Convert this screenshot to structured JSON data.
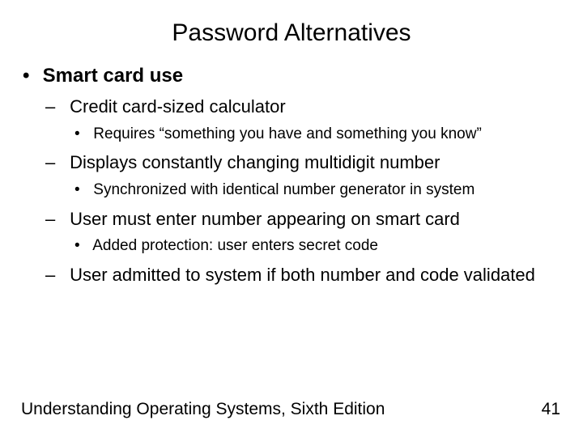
{
  "title": "Password Alternatives",
  "bullets": {
    "l1_0": "Smart card use",
    "l2_0": "Credit card-sized calculator",
    "l3_0": "Requires “something you have and something you know”",
    "l2_1": "Displays constantly changing multidigit number",
    "l3_1": "Synchronized with identical number generator in system",
    "l2_2": "User must enter number appearing on smart card",
    "l3_2": "Added protection: user enters secret code",
    "l2_3": "User admitted to system if both number and code validated"
  },
  "footer": {
    "source": "Understanding Operating Systems, Sixth Edition",
    "page": "41"
  }
}
